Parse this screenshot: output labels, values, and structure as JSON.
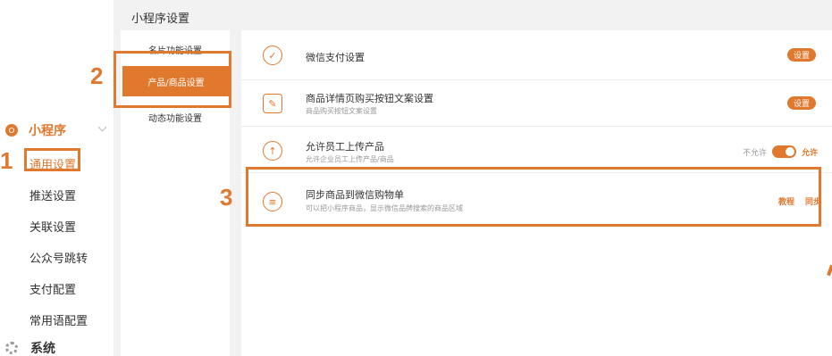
{
  "sidebar": {
    "group_label": "小程序",
    "items": [
      "通用设置",
      "推送设置",
      "关联设置",
      "公众号跳转",
      "支付配置",
      "常用语配置"
    ],
    "system_label": "系统"
  },
  "annotations": {
    "step1": "1",
    "step2": "2",
    "step3": "3"
  },
  "main": {
    "title": "小程序设置",
    "subnav": [
      "名片功能设置",
      "产品/商品设置",
      "动态功能设置"
    ]
  },
  "settings": [
    {
      "title": "微信支付设置",
      "subtitle": "",
      "button": "设置"
    },
    {
      "title": "商品详情页购买按钮文案设置",
      "subtitle": "商品购买按钮文案设置",
      "button": "设置"
    },
    {
      "title": "允许员工上传产品",
      "subtitle": "允许企业员工上传产品/商品",
      "toggle_off": "不允许",
      "toggle_on": "允许"
    },
    {
      "title": "同步商品到微信购物单",
      "subtitle": "可以把小程序商品，显示微信品牌搜索的商品区域",
      "link1": "教程",
      "link2": "同步"
    }
  ],
  "colors": {
    "accent": "#e0782e"
  }
}
